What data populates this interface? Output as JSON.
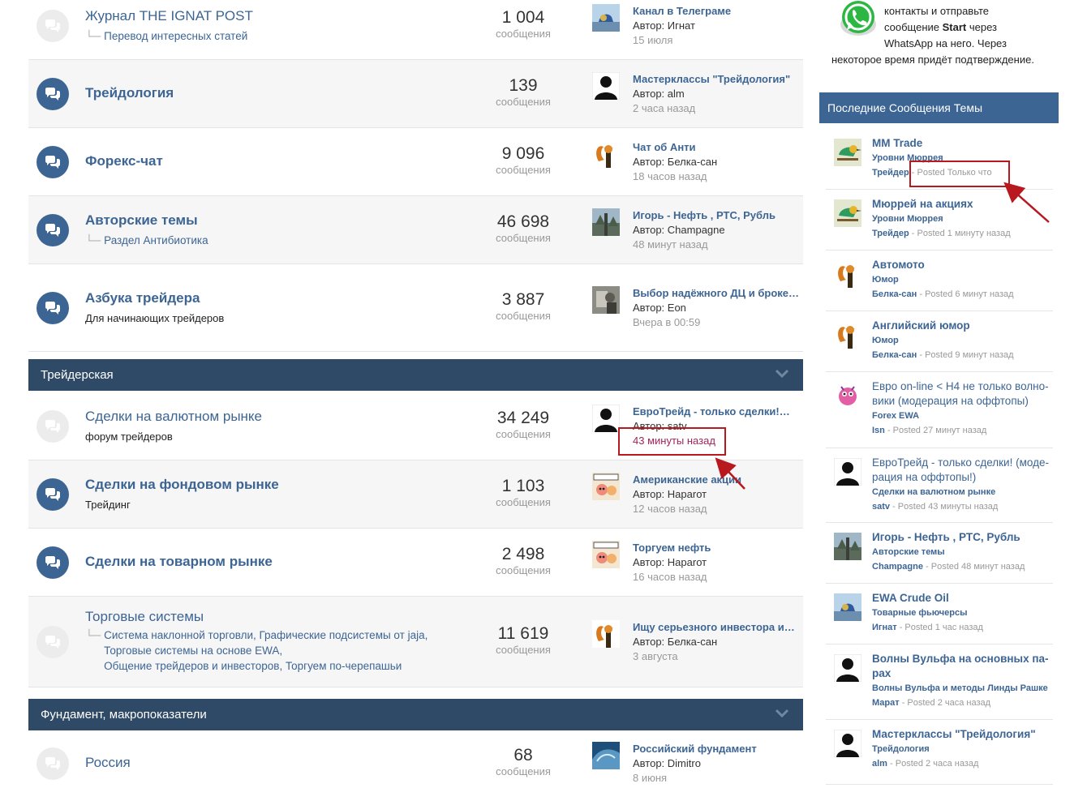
{
  "forums_top": [
    {
      "name": "Журнал THE IGNAT POST",
      "bold": false,
      "unread": false,
      "sub": [
        "Перевод интересных статей"
      ],
      "count": "1 004",
      "last_title": "Канал в Телеграме",
      "last_author": "Автор: Игнат",
      "last_time": "15 июля",
      "avatar": "bird-blue"
    },
    {
      "name": "Трейдология",
      "bold": true,
      "unread": true,
      "count": "139",
      "last_title": "Мастерклассы \"Трейдология\"",
      "last_author": "Автор: alm",
      "last_time": "2 часа назад",
      "avatar": "silhouette"
    },
    {
      "name": "Форекс-чат",
      "bold": true,
      "unread": true,
      "count": "9 096",
      "last_title": "Чат об Анти",
      "last_author": "Автор: Белка-сан",
      "last_time": "18 часов назад",
      "avatar": "squirrel"
    },
    {
      "name": "Авторские темы",
      "bold": true,
      "unread": true,
      "sub": [
        "Раздел Антибиотика"
      ],
      "count": "46 698",
      "last_title": "Игорь - Нефть , РТС, Рубль",
      "last_author": "Автор: Champagne",
      "last_time": "48 минут назад",
      "avatar": "forest"
    },
    {
      "name": "Азбука трейдера",
      "bold": true,
      "unread": true,
      "desc": "Для начинающих трейдеров",
      "count": "3 887",
      "last_title": "Выбор надёжного ДЦ и броке…",
      "last_author": "Автор: Eon",
      "last_time": "Вчера в 00:59",
      "avatar": "photo"
    }
  ],
  "count_label": "сообщения",
  "category_1": "Трейдерская",
  "forums_trade": [
    {
      "name": "Сделки на валютном рынке",
      "bold": false,
      "unread": false,
      "desc": "форум трейдеров",
      "count": "34 249",
      "last_title": "ЕвроТрейд - только сделки!…",
      "last_author": "Автор: satv",
      "last_time": "43 минуты назад",
      "avatar": "silhouette"
    },
    {
      "name": "Сделки на фондовом рынке",
      "bold": true,
      "unread": true,
      "desc": "Трейдинг",
      "count": "1 103",
      "last_title": "Американские акции",
      "last_author": "Автор: Нараrот",
      "last_time": "12 часов назад",
      "avatar": "cartoon"
    },
    {
      "name": "Сделки на товарном рынке",
      "bold": true,
      "unread": true,
      "count": "2 498",
      "last_title": "Торгуем нефть",
      "last_author": "Автор: Нараrот",
      "last_time": "16 часов назад",
      "avatar": "cartoon"
    },
    {
      "name": "Торговые системы",
      "bold": false,
      "unread": false,
      "sub_lines": [
        "Система наклонной торговли,   Графические подсистемы от jaja,",
        "Торговые системы на основе EWA,",
        "Общение трейдеров и инвесторов,   Торгуем по-черепашьи"
      ],
      "count": "11 619",
      "last_title": "Ищу серьезного инвестора и…",
      "last_author": "Автор: Белка-сан",
      "last_time": "3 августа",
      "avatar": "squirrel"
    }
  ],
  "category_2": "Фундамент, макропоказатели",
  "forums_macro": [
    {
      "name": "Россия",
      "bold": false,
      "unread": false,
      "count": "68",
      "last_title": "Российский фундамент",
      "last_author": "Автор: Dimitro",
      "last_time": "8 июня",
      "avatar": "wave"
    }
  ],
  "whatsapp": {
    "line1": "контакты и отправьте",
    "line2_pre": "сообщение ",
    "line2_bold": "Start",
    "line2_post": " через",
    "line3": "WhatsApp на него. Через",
    "line4": "некоторое время придёт подтверждение."
  },
  "sidebar_title": "Последние  Сообщения Темы",
  "posted_word": " - Posted ",
  "recent": [
    {
      "title": "MM Trade",
      "forum": "Уровни Мюррея",
      "user": "Трейдер",
      "time": "Только что",
      "avatar": "bee-eater"
    },
    {
      "title": "Мюррей на акциях",
      "forum": "Уровни Мюррея",
      "user": "Трейдер",
      "time": "1 минуту назад",
      "avatar": "bee-eater"
    },
    {
      "title": "Автомото",
      "forum": "Юмор",
      "user": "Белка-сан",
      "time": "6 минут назад",
      "avatar": "squirrel"
    },
    {
      "title": "Английский юмор",
      "forum": "Юмор",
      "user": "Белка-сан",
      "time": "9 минут назад",
      "avatar": "squirrel"
    },
    {
      "title": "Евро on-line < H4 не только волно-вики (модерация на оффтопы)",
      "forum": "Forex EWA",
      "user": "Isn",
      "time": "27 минут назад",
      "avatar": "smesharik",
      "plain": true
    },
    {
      "title": "ЕвроТрейд - только сделки! (моде-рация на оффтопы!)",
      "forum": "Сделки на валютном рынке",
      "user": "satv",
      "time": "43 минуты назад",
      "avatar": "silhouette",
      "plain": true
    },
    {
      "title": "Игорь - Нефть , РТС, Рубль",
      "forum": "Авторские темы",
      "user": "Champagne",
      "time": "48 минут назад",
      "avatar": "forest"
    },
    {
      "title": "EWA Crude Oil",
      "forum": "Товарные фьючерсы",
      "user": "Игнат",
      "time": "1 час назад",
      "avatar": "bird-blue"
    },
    {
      "title": "Волны Вульфа на основных па-рах",
      "forum": "Волны Вульфа и методы Линды Рашке",
      "user": "Марат",
      "time": "2 часа назад",
      "avatar": "silhouette"
    },
    {
      "title": "Мастерклассы \"Трейдология\"",
      "forum": "Трейдология",
      "user": "alm",
      "time": "2 часа назад",
      "avatar": "silhouette"
    }
  ]
}
